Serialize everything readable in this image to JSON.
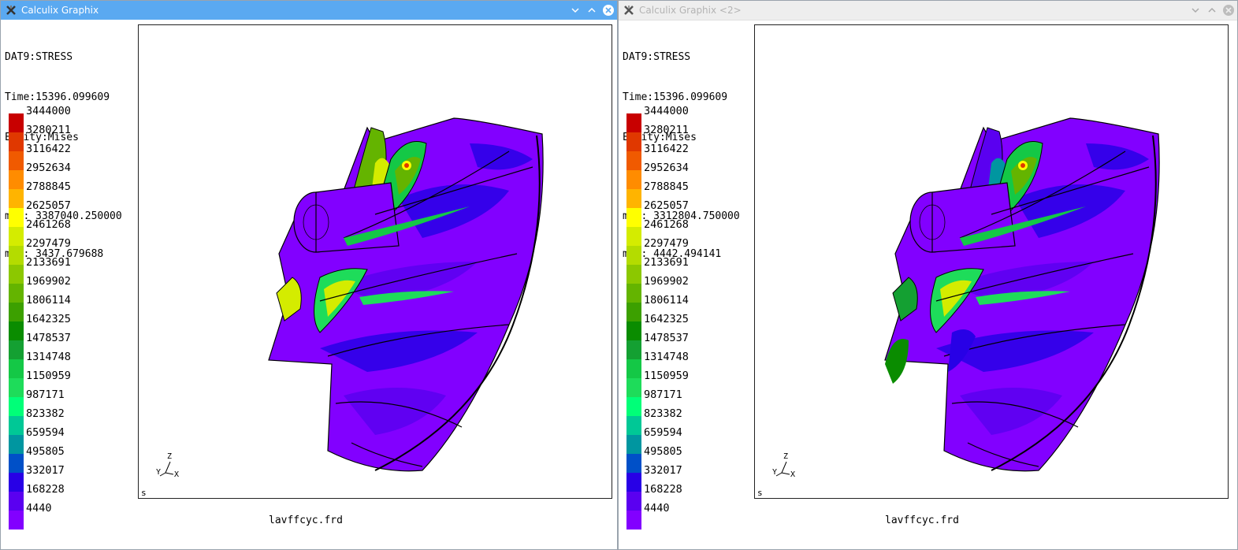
{
  "windows": [
    {
      "title": "Calculix Graphix",
      "info": {
        "dataset": "DAT9:STRESS",
        "time": "Time:15396.099609",
        "entity": "Entity:Mises",
        "max": "max: 3387040.250000",
        "min": "min: 3437.679688"
      },
      "filename": "lavffcyc.frd",
      "corner": "s"
    },
    {
      "title": "Calculix Graphix <2>",
      "info": {
        "dataset": "DAT9:STRESS",
        "time": "Time:15396.099609",
        "entity": "Entity:Mises",
        "max": "max: 3312804.750000",
        "min": "min: 4442.494141"
      },
      "filename": "lavffcyc.frd",
      "corner": "s"
    }
  ],
  "legend": {
    "values": [
      "3444000",
      "3280211",
      "3116422",
      "2952634",
      "2788845",
      "2625057",
      "2461268",
      "2297479",
      "2133691",
      "1969902",
      "1806114",
      "1642325",
      "1478537",
      "1314748",
      "1150959",
      "987171",
      "823382",
      "659594",
      "495805",
      "332017",
      "168228",
      "4440"
    ],
    "colors": [
      "#c80000",
      "#e03800",
      "#f05a00",
      "#ff8c00",
      "#ffb400",
      "#ffff00",
      "#d4ec00",
      "#b4dc00",
      "#8cc800",
      "#64b400",
      "#3ca000",
      "#0a8c00",
      "#14a032",
      "#14c846",
      "#1edc5a",
      "#00ff78",
      "#00c896",
      "#0096a0",
      "#0050c8",
      "#2800e6",
      "#5a00f0",
      "#8200ff"
    ]
  },
  "axes": {
    "z": "Z",
    "y": "Y",
    "x": "X"
  },
  "icons": {
    "app": "calculix-app-icon",
    "minimize": "chevron-down-icon",
    "maximize": "chevron-up-icon",
    "close": "close-icon"
  }
}
